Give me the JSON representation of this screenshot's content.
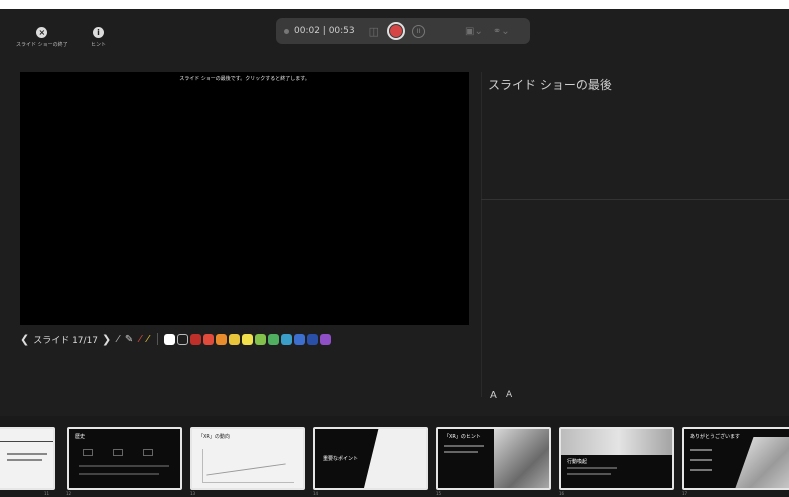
{
  "top_controls": {
    "end_show_label": "スライド ショーの終了",
    "hint_label": "ヒント"
  },
  "recording": {
    "time": "00:02 | 00:53"
  },
  "slide": {
    "message": "スライド ショーの最後です。クリックすると終了します。"
  },
  "notes": {
    "title": "スライド ショーの最後"
  },
  "toolbar": {
    "prev": "❮",
    "counter": "スライド 17/17",
    "next": "❯",
    "pen_colors": [
      "#ffffff",
      "#1e1e1e",
      "#c0302b",
      "#e04b3c",
      "#e98d2c",
      "#e8c53b",
      "#f2df4c",
      "#84c04c",
      "#4fae5f",
      "#3a9ec8",
      "#3d6fce",
      "#2a4fa8",
      "#8e4fc7"
    ]
  },
  "font_buttons": {
    "increase": "A",
    "decrease": "A"
  },
  "filmstrip": {
    "slides": [
      {
        "num": "11",
        "title": ""
      },
      {
        "num": "12",
        "title": "歴史"
      },
      {
        "num": "13",
        "title": "「XR」の動向"
      },
      {
        "num": "14",
        "title": "重要なポイント"
      },
      {
        "num": "15",
        "title": "「XR」のヒント"
      },
      {
        "num": "16",
        "title": "行動喚起"
      },
      {
        "num": "17",
        "title": "ありがとうございます"
      }
    ]
  }
}
